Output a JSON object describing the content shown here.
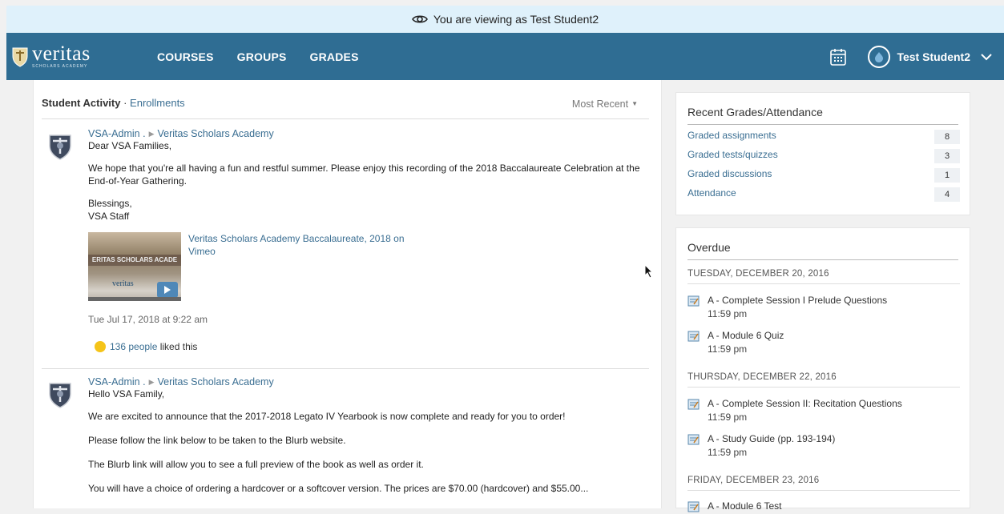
{
  "masquerade": {
    "text": "You are viewing as Test Student2"
  },
  "header": {
    "logo_word": "veritas",
    "logo_sub": "SCHOLARS ACADEMY",
    "nav": [
      "COURSES",
      "GROUPS",
      "GRADES"
    ],
    "user_name": "Test Student2"
  },
  "feed": {
    "title": "Student Activity",
    "separator": " · ",
    "subtitle": "Enrollments",
    "sort": "Most Recent",
    "posts": [
      {
        "author": "VSA-Admin .",
        "group": "Veritas Scholars Academy",
        "lines": [
          "Dear VSA Families,",
          "We hope that you're all having a fun and restful summer. Please enjoy this recording of the 2018 Baccalaureate Celebration at the",
          "End-of-Year Gathering.",
          "Blessings,",
          "VSA Staff"
        ],
        "thumb_banner": "ERITAS SCHOLARS ACADE",
        "thumb_logo": "veritas",
        "video_title_1": "Veritas Scholars Academy Baccalaureate, 2018 on",
        "video_title_2": "Vimeo",
        "timestamp": "Tue Jul 17, 2018 at 9:22 am",
        "likes_count": "136 people",
        "likes_suffix": " liked this"
      },
      {
        "author": "VSA-Admin .",
        "group": "Veritas Scholars Academy",
        "lines": [
          "Hello VSA Family,",
          "We are excited to announce that the 2017-2018 Legato IV Yearbook is now complete and ready for you to order!",
          "Please follow the link below to be taken to the Blurb website.",
          "The Blurb link will allow you to see a full preview of the book as well as order it.",
          "You will have a choice of ordering a hardcover or a softcover version. The prices are $70.00 (hardcover) and $55.00..."
        ]
      }
    ]
  },
  "grades": {
    "title": "Recent Grades/Attendance",
    "rows": [
      {
        "label": "Graded assignments",
        "count": "8"
      },
      {
        "label": "Graded tests/quizzes",
        "count": "3"
      },
      {
        "label": "Graded discussions",
        "count": "1"
      },
      {
        "label": "Attendance",
        "count": "4"
      }
    ]
  },
  "overdue": {
    "title": "Overdue",
    "days": [
      {
        "date": "TUESDAY, DECEMBER 20, 2016",
        "tasks": [
          {
            "name": "A - Complete Session I Prelude Questions",
            "time": "11:59 pm"
          },
          {
            "name": "A - Module 6 Quiz",
            "time": "11:59 pm"
          }
        ]
      },
      {
        "date": "THURSDAY, DECEMBER 22, 2016",
        "tasks": [
          {
            "name": "A - Complete Session II: Recitation Questions",
            "time": "11:59 pm"
          },
          {
            "name": "A - Study Guide (pp. 193-194)",
            "time": "11:59 pm"
          }
        ]
      },
      {
        "date": "FRIDAY, DECEMBER 23, 2016",
        "tasks": [
          {
            "name": "A - Module 6 Test",
            "time": ""
          }
        ]
      }
    ]
  },
  "colors": {
    "topbar": "#2f6d93",
    "masquerade_bg": "#dff1fb",
    "link": "#3a6e92"
  },
  "icons": [
    "eye-icon",
    "shield-logo-icon",
    "calendar-icon",
    "avatar-icon",
    "chevron-down-icon",
    "assignment-icon",
    "play-icon",
    "smiley-icon",
    "cursor-icon"
  ]
}
